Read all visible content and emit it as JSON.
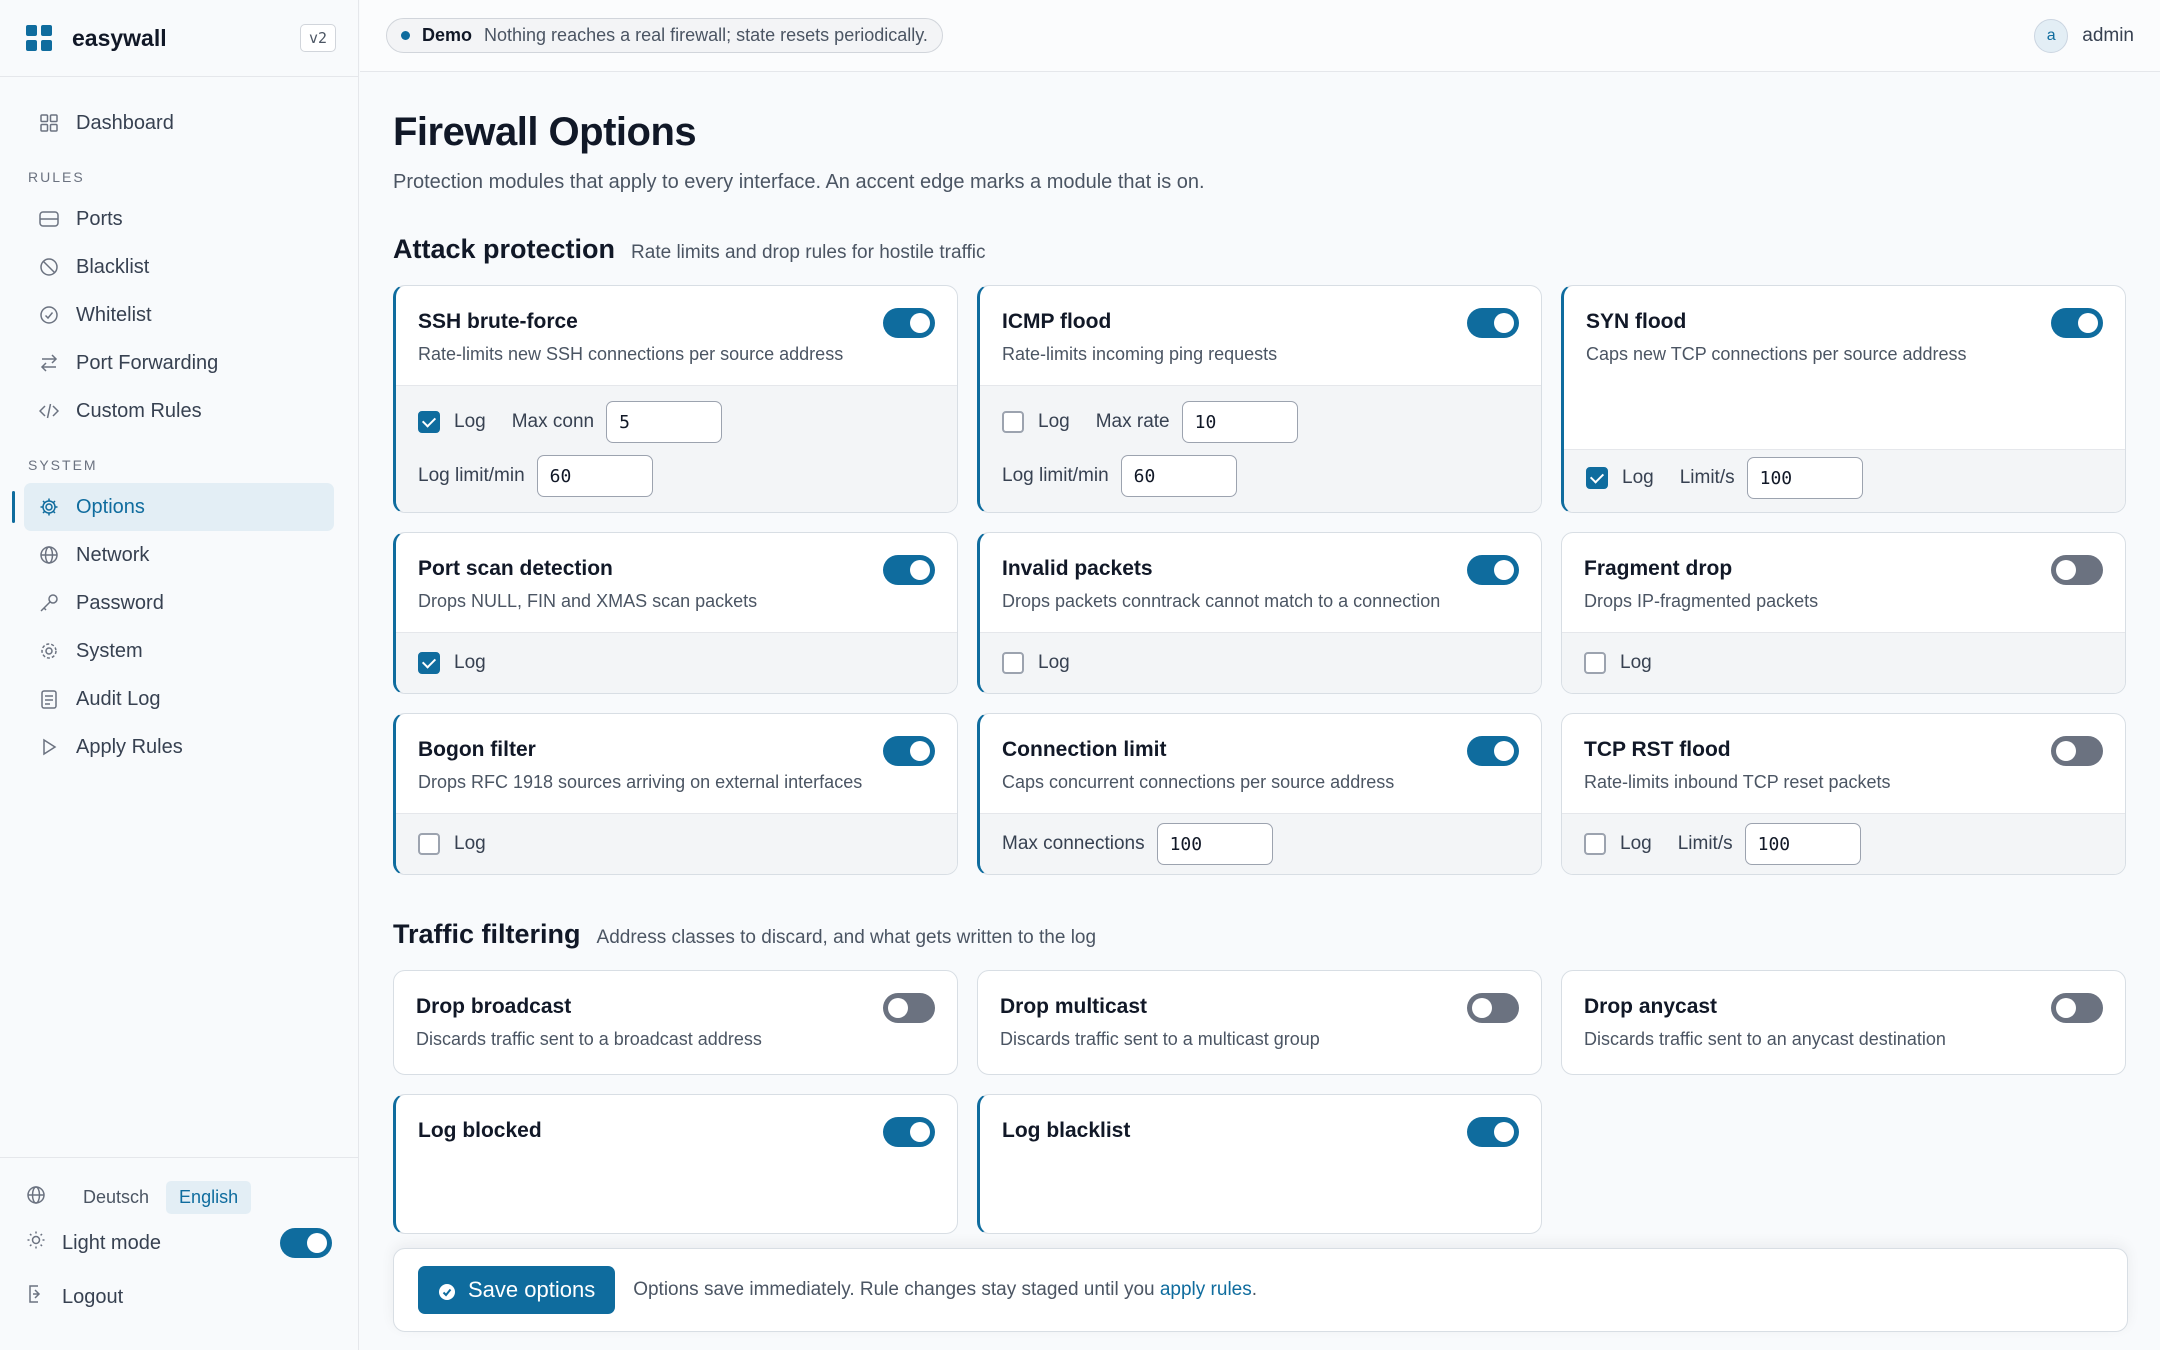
{
  "app": {
    "name": "easywall",
    "version": "v2"
  },
  "topbar": {
    "demo_label": "Demo",
    "demo_text": "Nothing reaches a real firewall; state resets periodically.",
    "avatar_letter": "a",
    "user": "admin"
  },
  "nav": {
    "dashboard": "Dashboard",
    "rules_section": "RULES",
    "ports": "Ports",
    "blacklist": "Blacklist",
    "whitelist": "Whitelist",
    "port_forwarding": "Port Forwarding",
    "custom_rules": "Custom Rules",
    "system_section": "SYSTEM",
    "options": "Options",
    "network": "Network",
    "password": "Password",
    "system": "System",
    "audit_log": "Audit Log",
    "apply_rules": "Apply Rules",
    "active": "options"
  },
  "sidebar_bottom": {
    "lang_de": "Deutsch",
    "lang_en": "English",
    "selected_lang": "English",
    "light_mode": "Light mode",
    "light_mode_on": true,
    "logout": "Logout"
  },
  "page": {
    "title": "Firewall Options",
    "subtitle": "Protection modules that apply to every interface. An accent edge marks a module that is on."
  },
  "attack": {
    "title": "Attack protection",
    "subtitle": "Rate limits and drop rules for hostile traffic",
    "ssh": {
      "title": "SSH brute-force",
      "desc": "Rate-limits new SSH connections per source address",
      "enabled": true,
      "log": true,
      "log_label": "Log",
      "max_conn_label": "Max conn",
      "max_conn": "5",
      "log_limit_label": "Log limit/min",
      "log_limit": "60"
    },
    "icmp": {
      "title": "ICMP flood",
      "desc": "Rate-limits incoming ping requests",
      "enabled": true,
      "log": false,
      "log_label": "Log",
      "max_rate_label": "Max rate",
      "max_rate": "10",
      "log_limit_label": "Log limit/min",
      "log_limit": "60"
    },
    "syn": {
      "title": "SYN flood",
      "desc": "Caps new TCP connections per source address",
      "enabled": true,
      "log": true,
      "log_label": "Log",
      "limit_label": "Limit/s",
      "limit": "100"
    },
    "portscan": {
      "title": "Port scan detection",
      "desc": "Drops NULL, FIN and XMAS scan packets",
      "enabled": true,
      "log": true,
      "log_label": "Log"
    },
    "invalid": {
      "title": "Invalid packets",
      "desc": "Drops packets conntrack cannot match to a connection",
      "enabled": true,
      "log": false,
      "log_label": "Log"
    },
    "fragment": {
      "title": "Fragment drop",
      "desc": "Drops IP-fragmented packets",
      "enabled": false,
      "log": false,
      "log_label": "Log"
    },
    "bogon": {
      "title": "Bogon filter",
      "desc": "Drops RFC 1918 sources arriving on external interfaces",
      "enabled": true,
      "log": false,
      "log_label": "Log"
    },
    "connlimit": {
      "title": "Connection limit",
      "desc": "Caps concurrent connections per source address",
      "enabled": true,
      "max_conn_label": "Max connections",
      "max_conn": "100"
    },
    "rst": {
      "title": "TCP RST flood",
      "desc": "Rate-limits inbound TCP reset packets",
      "enabled": false,
      "log": false,
      "log_label": "Log",
      "limit_label": "Limit/s",
      "limit": "100"
    }
  },
  "traffic": {
    "title": "Traffic filtering",
    "subtitle": "Address classes to discard, and what gets written to the log",
    "broadcast": {
      "title": "Drop broadcast",
      "desc": "Discards traffic sent to a broadcast address",
      "enabled": false
    },
    "multicast": {
      "title": "Drop multicast",
      "desc": "Discards traffic sent to a multicast group",
      "enabled": false
    },
    "anycast": {
      "title": "Drop anycast",
      "desc": "Discards traffic sent to an anycast destination",
      "enabled": false
    },
    "log_blocked": {
      "title": "Log blocked",
      "enabled": true
    },
    "log_blacklist": {
      "title": "Log blacklist",
      "enabled": true
    }
  },
  "savebar": {
    "button": "Save options",
    "note": "Options save immediately. Rule changes stay staged until you",
    "link": "apply rules",
    "period": "."
  },
  "colors": {
    "accent": "#0f6c9e",
    "toggle_off": "#6b7280"
  }
}
